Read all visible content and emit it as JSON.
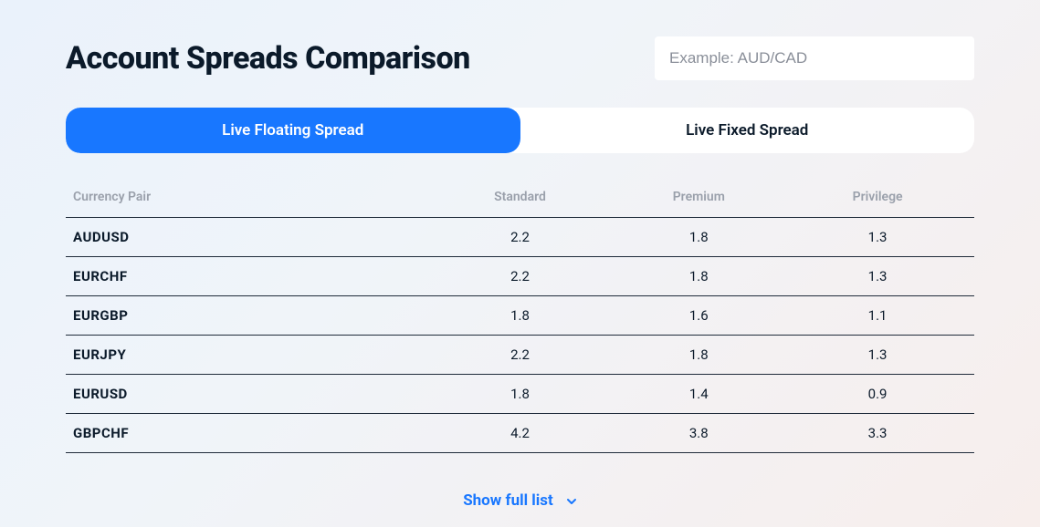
{
  "header": {
    "title": "Account Spreads Comparison",
    "search_placeholder": "Example: AUD/CAD"
  },
  "tabs": {
    "floating": "Live Floating Spread",
    "fixed": "Live Fixed Spread",
    "active": "floating"
  },
  "table": {
    "headers": {
      "pair": "Currency Pair",
      "standard": "Standard",
      "premium": "Premium",
      "privilege": "Privilege"
    },
    "rows": [
      {
        "pair": "AUDUSD",
        "standard": "2.2",
        "premium": "1.8",
        "privilege": "1.3"
      },
      {
        "pair": "EURCHF",
        "standard": "2.2",
        "premium": "1.8",
        "privilege": "1.3"
      },
      {
        "pair": "EURGBP",
        "standard": "1.8",
        "premium": "1.6",
        "privilege": "1.1"
      },
      {
        "pair": "EURJPY",
        "standard": "2.2",
        "premium": "1.8",
        "privilege": "1.3"
      },
      {
        "pair": "EURUSD",
        "standard": "1.8",
        "premium": "1.4",
        "privilege": "0.9"
      },
      {
        "pair": "GBPCHF",
        "standard": "4.2",
        "premium": "3.8",
        "privilege": "3.3"
      }
    ]
  },
  "footer": {
    "show_more": "Show full list"
  },
  "colors": {
    "accent": "#1877ff"
  }
}
